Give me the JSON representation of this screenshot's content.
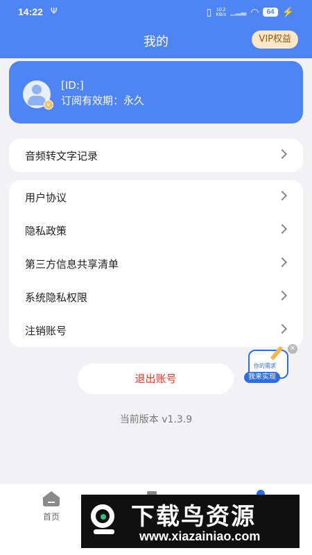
{
  "status_bar": {
    "time": "14:22",
    "usb_symbol": "Ψ",
    "net_speed_value": "10.2",
    "net_speed_unit": "KB/s",
    "battery": "64"
  },
  "header": {
    "title": "我的",
    "vip_button": "VIP权益"
  },
  "profile": {
    "id_label": "[ID:]",
    "subscription_text": "订阅有效期：永久"
  },
  "menu_group_1": [
    {
      "label": "音频转文字记录"
    }
  ],
  "menu_group_2": [
    {
      "label": "用户协议"
    },
    {
      "label": "隐私政策"
    },
    {
      "label": "第三方信息共享清单"
    },
    {
      "label": "系统隐私权限"
    },
    {
      "label": "注销账号"
    }
  ],
  "logout_button": "退出账号",
  "floating_widget": {
    "paper_text": "你的需求",
    "tag": "我来实现"
  },
  "version_text": "当前版本 v1.3.9",
  "tab_bar": {
    "home_label": "首页"
  },
  "watermark": {
    "title": "下载鸟资源",
    "url": "www.xiazainiao.com"
  },
  "colors": {
    "primary": "#4f84f5",
    "accent_blue": "#2d6ee6",
    "logout_red": "#e23b2e",
    "vip_bg": "#fde8c8"
  }
}
